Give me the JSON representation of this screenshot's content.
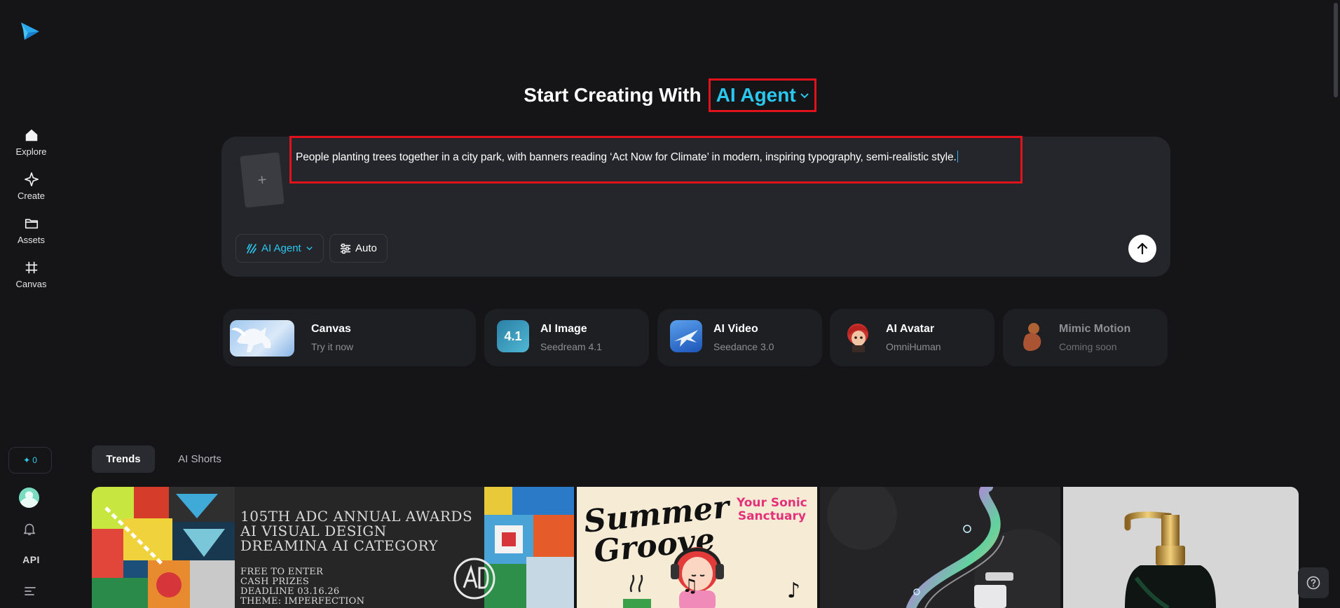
{
  "sidebar": {
    "logo_icon": "paper-plane-logo",
    "items": [
      {
        "label": "Explore",
        "icon": "home-icon"
      },
      {
        "label": "Create",
        "icon": "sparkle-icon"
      },
      {
        "label": "Assets",
        "icon": "folder-icon"
      },
      {
        "label": "Canvas",
        "icon": "crop-icon"
      }
    ],
    "credits": "0",
    "api_label": "API"
  },
  "heading": {
    "prefix": "Start Creating With",
    "mode": "AI Agent"
  },
  "prompt": {
    "text": "People planting trees together in a city park, with banners reading ‘Act Now for Climate’ in modern, inspiring typography, semi-realistic style.",
    "upload_symbol": "+",
    "mode_pill": "AI Agent",
    "settings_pill": "Auto"
  },
  "tools": [
    {
      "title": "Canvas",
      "subtitle": "Try it now"
    },
    {
      "title": "AI Image",
      "subtitle": "Seedream 4.1",
      "badge": "4.1"
    },
    {
      "title": "AI Video",
      "subtitle": "Seedance 3.0"
    },
    {
      "title": "AI Avatar",
      "subtitle": "OmniHuman"
    },
    {
      "title": "Mimic Motion",
      "subtitle": "Coming soon"
    }
  ],
  "tabs": [
    "Trends",
    "AI Shorts"
  ],
  "gallery": {
    "adc": {
      "title_lines": [
        "105TH ADC ANNUAL AWARDS",
        "AI VISUAL DESIGN",
        "DREAMINA AI CATEGORY"
      ],
      "detail_lines": [
        "FREE TO ENTER",
        "CASH PRIZES",
        "DEADLINE 03.16.26",
        "THEME: IMPERFECTION"
      ]
    },
    "summer": {
      "title_lines": [
        "Summer",
        "Groove"
      ],
      "tag_lines": [
        "Your Sonic",
        "Sanctuary"
      ]
    }
  },
  "colors": {
    "background": "#151517",
    "accent": "#2ac7ee",
    "highlight": "#e0121b"
  }
}
